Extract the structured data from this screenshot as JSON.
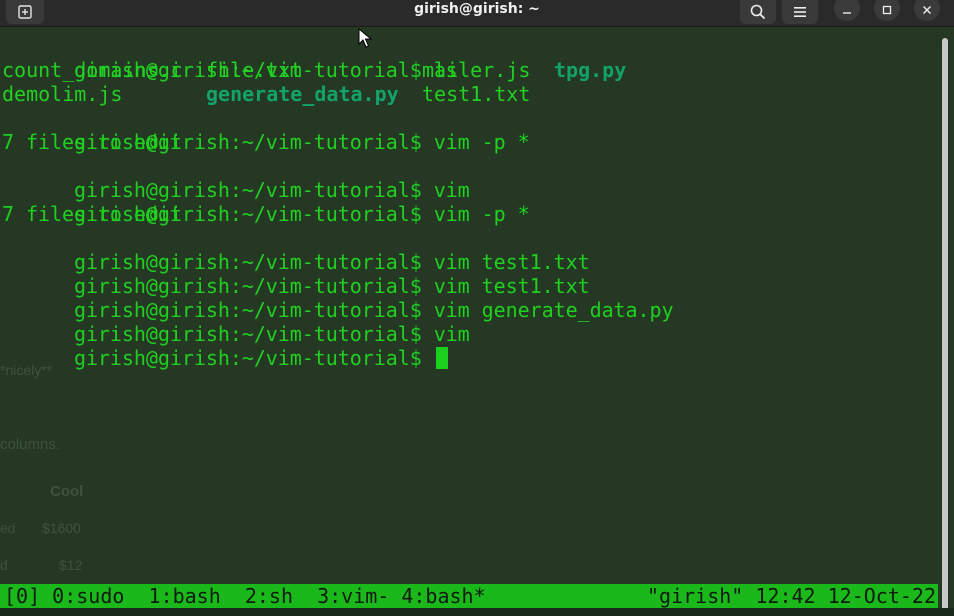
{
  "window": {
    "title": "girish@girish: ~"
  },
  "titlebar": {
    "new_tab_icon": "new-tab-icon",
    "search_icon": "search-icon",
    "menu_icon": "hamburger-menu-icon",
    "minimize_icon": "minimize-icon",
    "maximize_icon": "maximize-icon",
    "close_icon": "close-icon"
  },
  "terminal": {
    "prompt": "girish@girish:~/vim-tutorial$",
    "lines": [
      {
        "prompt": "girish@girish:~/vim-tutorial$",
        "cmd": " ls"
      },
      {
        "prompt": "girish@girish:~/vim-tutorial$",
        "cmd": " vim -p *"
      },
      {
        "output": "7 files to edit"
      },
      {
        "prompt": "girish@girish:~/vim-tutorial$",
        "cmd": " vim"
      },
      {
        "prompt": "girish@girish:~/vim-tutorial$",
        "cmd": " vim -p *"
      },
      {
        "output": "7 files to edit"
      },
      {
        "prompt": "girish@girish:~/vim-tutorial$",
        "cmd": " vim test1.txt"
      },
      {
        "prompt": "girish@girish:~/vim-tutorial$",
        "cmd": " vim test1.txt"
      },
      {
        "prompt": "girish@girish:~/vim-tutorial$",
        "cmd": " vim generate_data.py"
      },
      {
        "prompt": "girish@girish:~/vim-tutorial$",
        "cmd": " vim"
      },
      {
        "prompt": "girish@girish:~/vim-tutorial$",
        "cmd": " "
      }
    ],
    "ls_output": [
      {
        "name": "count_domains.c",
        "exec": false
      },
      {
        "name": "file.txt",
        "exec": false
      },
      {
        "name": "mailer.js",
        "exec": false
      },
      {
        "name": "tpg.py",
        "exec": true
      },
      {
        "name": "demolim.js",
        "exec": false
      },
      {
        "name": "generate_data.py",
        "exec": true
      },
      {
        "name": "test1.txt",
        "exec": false
      }
    ],
    "background_ghost_text": {
      "nicely": "*nicely**",
      "columns": "columns.",
      "cool": "Cool",
      "ed": "ed",
      "price1": "$1600",
      "d": "d",
      "price2": "$12"
    }
  },
  "tmux_status": {
    "left": "[0] 0:sudo  1:bash  2:sh  3:vim- 4:bash*",
    "right": "\"girish\" 12:42 12-Oct-22"
  },
  "colors": {
    "terminal_bg": "#243824",
    "text_green": "#1fd01f",
    "exec_green": "#13a36a",
    "status_bg": "#1bb81b",
    "titlebar_bg": "#2a2a2a"
  }
}
